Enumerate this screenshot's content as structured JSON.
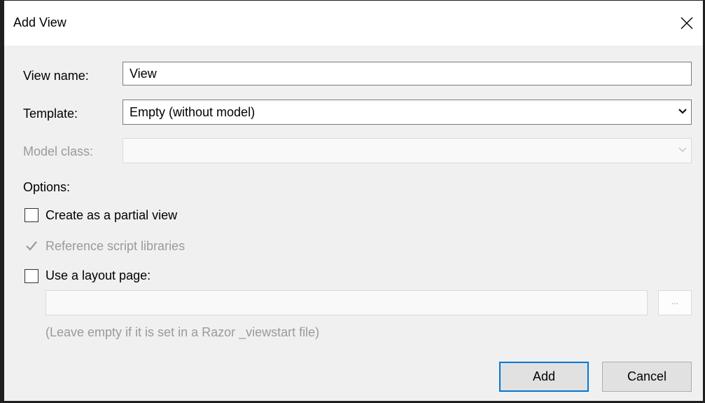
{
  "dialog": {
    "title": "Add View",
    "close_icon": "close-icon"
  },
  "form": {
    "view_name_label": "View name:",
    "view_name_value": "View",
    "template_label": "Template:",
    "template_value": "Empty (without model)",
    "model_class_label": "Model class:",
    "model_class_value": "",
    "options_label": "Options:"
  },
  "options": {
    "partial_view_label": "Create as a partial view",
    "partial_view_checked": false,
    "reference_scripts_label": "Reference script libraries",
    "reference_scripts_checked": true,
    "layout_page_label": "Use a layout page:",
    "layout_page_checked": false,
    "layout_path_value": "",
    "browse_label": "...",
    "layout_hint": "(Leave empty if it is set in a Razor _viewstart file)"
  },
  "buttons": {
    "add_label": "Add",
    "cancel_label": "Cancel"
  },
  "colors": {
    "accent": "#0078d7",
    "disabled_text": "#9a9a9a"
  }
}
